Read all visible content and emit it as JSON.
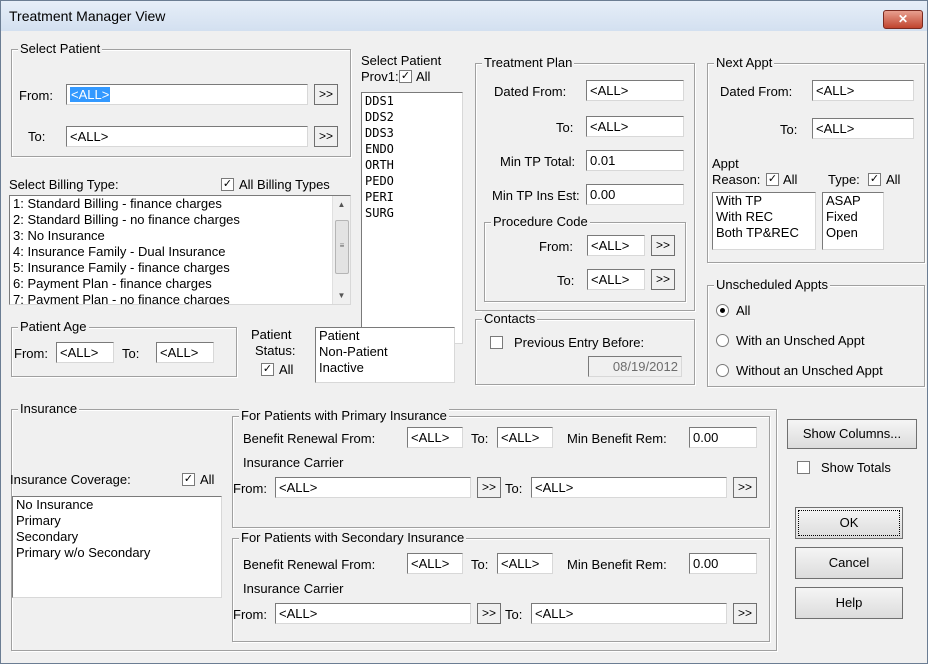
{
  "window": {
    "title": "Treatment Manager View",
    "close_icon": "x-icon"
  },
  "select_patient": {
    "title": "Select Patient",
    "from_label": "From:",
    "from_value": "<ALL>",
    "to_label": "To:",
    "to_value": "<ALL>",
    "browse_label": ">>"
  },
  "provider": {
    "title": "Select Patient",
    "prov_label": "Prov1:",
    "all_label": "All",
    "all_checked": true,
    "items": [
      "DDS1",
      "DDS2",
      "DDS3",
      "ENDO",
      "ORTH",
      "PEDO",
      "PERI",
      "SURG"
    ]
  },
  "treatment_plan": {
    "title": "Treatment Plan",
    "dated_from_label": "Dated From:",
    "dated_from_value": "<ALL>",
    "to_label": "To:",
    "to_value": "<ALL>",
    "min_total_label": "Min TP Total:",
    "min_total_value": "0.01",
    "min_ins_label": "Min TP Ins Est:",
    "min_ins_value": "0.00",
    "procedure_code": {
      "title": "Procedure Code",
      "from_label": "From:",
      "from_value": "<ALL>",
      "to_label": "To:",
      "to_value": "<ALL>",
      "browse_label": ">>"
    }
  },
  "next_appt": {
    "title": "Next Appt",
    "dated_from_label": "Dated From:",
    "dated_from_value": "<ALL>",
    "to_label": "To:",
    "to_value": "<ALL>",
    "appt_label": "Appt",
    "reason_label": "Reason:",
    "reason_all_label": "All",
    "reason_all_checked": true,
    "type_label": "Type:",
    "type_all_label": "All",
    "type_all_checked": true,
    "reasons": [
      "With TP",
      "With REC",
      "Both TP&REC"
    ],
    "types": [
      "ASAP",
      "Fixed",
      "Open"
    ]
  },
  "billing": {
    "title": "Select Billing Type:",
    "all_label": "All Billing Types",
    "all_checked": true,
    "items": [
      "1: Standard Billing - finance charges",
      "2: Standard Billing - no finance charges",
      "3: No Insurance",
      "4: Insurance Family - Dual Insurance",
      "5: Insurance Family - finance charges",
      "6: Payment Plan - finance charges",
      "7: Payment Plan - no finance charges"
    ]
  },
  "patient_age": {
    "title": "Patient Age",
    "from_label": "From:",
    "from_value": "<ALL>",
    "to_label": "To:",
    "to_value": "<ALL>"
  },
  "patient_status": {
    "label1": "Patient",
    "label2": "Status:",
    "all_label": "All",
    "all_checked": true,
    "items": [
      "Patient",
      "Non-Patient",
      "Inactive"
    ]
  },
  "contacts": {
    "title": "Contacts",
    "previous_label": "Previous Entry Before:",
    "previous_checked": false,
    "date_value": "08/19/2012"
  },
  "unscheduled": {
    "title": "Unscheduled Appts",
    "options": [
      "All",
      "With an Unsched Appt",
      "Without an Unsched Appt"
    ],
    "selected": "All"
  },
  "insurance": {
    "title": "Insurance",
    "coverage_label": "Insurance Coverage:",
    "coverage_all_label": "All",
    "coverage_all_checked": true,
    "coverage_items": [
      "No Insurance",
      "Primary",
      "Secondary",
      "Primary w/o Secondary"
    ],
    "primary": {
      "title": "For Patients with Primary Insurance",
      "renewal_from_label": "Benefit Renewal From:",
      "renewal_from_value": "<ALL>",
      "renewal_to_label": "To:",
      "renewal_to_value": "<ALL>",
      "min_rem_label": "Min Benefit Rem:",
      "min_rem_value": "0.00",
      "carrier_label": "Insurance Carrier",
      "carrier_from_label": "From:",
      "carrier_from_value": "<ALL>",
      "carrier_to_label": "To:",
      "carrier_to_value": "<ALL>",
      "browse_label": ">>"
    },
    "secondary": {
      "title": "For Patients with Secondary Insurance",
      "renewal_from_label": "Benefit Renewal From:",
      "renewal_from_value": "<ALL>",
      "renewal_to_label": "To:",
      "renewal_to_value": "<ALL>",
      "min_rem_label": "Min Benefit Rem:",
      "min_rem_value": "0.00",
      "carrier_label": "Insurance Carrier",
      "carrier_from_label": "From:",
      "carrier_from_value": "<ALL>",
      "carrier_to_label": "To:",
      "carrier_to_value": "<ALL>",
      "browse_label": ">>"
    }
  },
  "buttons": {
    "show_columns": "Show Columns...",
    "show_totals": "Show Totals",
    "show_totals_checked": false,
    "ok": "OK",
    "cancel": "Cancel",
    "help": "Help"
  }
}
